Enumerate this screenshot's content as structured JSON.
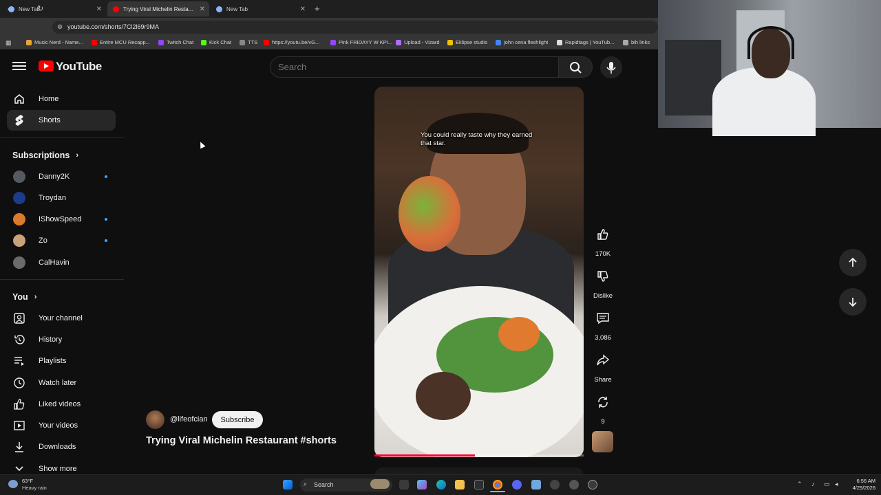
{
  "browser": {
    "tabs": [
      {
        "title": "New Tab",
        "active": false
      },
      {
        "title": "Trying Viral Michelin Resta...",
        "active": true
      },
      {
        "title": "New Tab",
        "active": false
      }
    ],
    "url": "youtube.com/shorts/7Cl2l69r9MA",
    "bookmarks": [
      {
        "label": "Music Nerd - Name...",
        "color": "#e8a33a"
      },
      {
        "label": "Entire MCU Recapp...",
        "color": "#ff0000"
      },
      {
        "label": "Twitch Chat",
        "color": "#9146ff"
      },
      {
        "label": "Kick Chat",
        "color": "#53fc18"
      },
      {
        "label": "TTS",
        "color": "#888888"
      },
      {
        "label": "https://youtu.be/vG...",
        "color": "#ff0000"
      },
      {
        "label": "Pink FRIDAYY W KPI...",
        "color": "#9146ff"
      },
      {
        "label": "Upload - Vizard",
        "color": "#b06cff"
      },
      {
        "label": "Eklipse studio",
        "color": "#f2c200"
      },
      {
        "label": "john cena fleshlight",
        "color": "#4285f4"
      },
      {
        "label": "Rapidtags | YouTub...",
        "color": "#dddddd"
      },
      {
        "label": "bih links",
        "color": "#aaaaaa"
      }
    ]
  },
  "header": {
    "logo_text": "YouTube",
    "search_placeholder": "Search"
  },
  "sidebar": {
    "main": [
      {
        "label": "Home",
        "icon": "home-icon"
      },
      {
        "label": "Shorts",
        "icon": "shorts-icon",
        "active": true
      }
    ],
    "subscriptions_heading": "Subscriptions",
    "subscriptions": [
      {
        "label": "Danny2K",
        "live": true,
        "color": "#555a60"
      },
      {
        "label": "Troydan",
        "live": false,
        "color": "#1e3a8a"
      },
      {
        "label": "IShowSpeed",
        "live": true,
        "color": "#d97b2a"
      },
      {
        "label": "Zo",
        "live": true,
        "color": "#c9a27a"
      },
      {
        "label": "CalHavin",
        "live": false,
        "color": "#6b6b6b"
      }
    ],
    "you_heading": "You",
    "you": [
      {
        "label": "Your channel",
        "icon": "channel-icon"
      },
      {
        "label": "History",
        "icon": "history-icon"
      },
      {
        "label": "Playlists",
        "icon": "playlists-icon"
      },
      {
        "label": "Watch later",
        "icon": "watch-later-icon"
      },
      {
        "label": "Liked videos",
        "icon": "liked-icon"
      },
      {
        "label": "Your videos",
        "icon": "your-videos-icon"
      },
      {
        "label": "Downloads",
        "icon": "downloads-icon"
      },
      {
        "label": "Show more",
        "icon": "chevron-down-icon"
      }
    ]
  },
  "short": {
    "caption": "You could really taste why they earned that star.",
    "progress": 0.48,
    "channel": "@lifeofcian",
    "subscribe_label": "Subscribe",
    "title": "Trying Viral Michelin Restaurant #shorts",
    "actions": {
      "like": "170K",
      "dislike": "Dislike",
      "comments": "3,086",
      "share": "Share",
      "remix": "9"
    }
  },
  "taskbar": {
    "weather_temp": "63°F",
    "weather_desc": "Heavy rain",
    "search_label": "Search",
    "time": "6:56 AM",
    "date": "4/29/2026"
  }
}
